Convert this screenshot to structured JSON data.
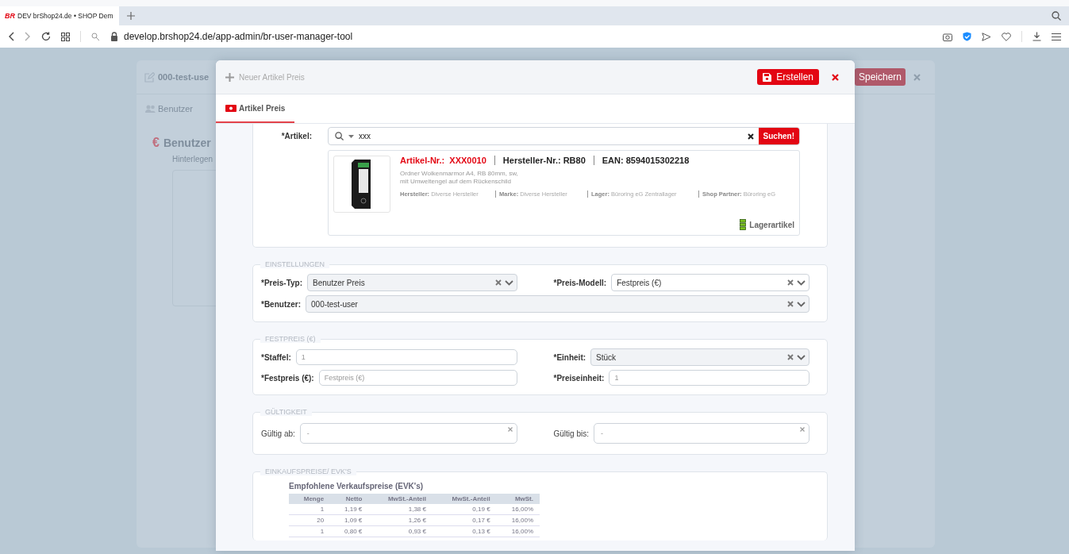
{
  "browser": {
    "logo": "BR",
    "tab_title": "DEV brShop24.de • SHOP Dem",
    "url": "develop.brshop24.de/app-admin/br-user-manager-tool"
  },
  "background": {
    "currency_symbol": "€",
    "title": "000-test-use",
    "tab": "Benutzer",
    "heading": "Benutzer",
    "subtitle": "Hinterlegen",
    "save_button": "Speichern"
  },
  "modal": {
    "title": "Neuer Artikel Preis",
    "create_button": "Erstellen",
    "tabs": [
      {
        "label": "Artikel Preis",
        "selected": true
      }
    ],
    "article": {
      "label": "*Artikel:",
      "search_value": "xxx",
      "search_button": "Suchen!",
      "result": {
        "article_no_label": "Artikel-Nr.:",
        "article_no": "XXX0010",
        "manufacturer_no": "Hersteller-Nr.: RB80",
        "ean": "EAN: 8594015302218",
        "description": [
          "Ordner Wolkenmarmor A4, RB 80mm, sw,",
          "mit Umweltengel auf dem Rückenschild"
        ],
        "attributes": [
          {
            "label": "Hersteller:",
            "value": "Diverse Hersteller"
          },
          {
            "label": "Marke:",
            "value": "Diverse Hersteller"
          },
          {
            "label": "Lager:",
            "value": "Büroring eG Zentrallager"
          },
          {
            "label": "Shop Partner:",
            "value": "Büroring eG"
          }
        ],
        "stock_label": "Lagerartikel"
      }
    },
    "sections": [
      {
        "legend": "EINSTELLUNGEN",
        "rows": [
          [
            {
              "label": "*Preis-Typ:",
              "kind": "select",
              "value": "Benutzer Preis",
              "disabled": true
            },
            {
              "label": "*Preis-Modell:",
              "kind": "select",
              "value": "Festpreis (€)",
              "disabled": false
            }
          ],
          [
            {
              "label": "*Benutzer:",
              "kind": "select",
              "value": "000-test-user",
              "disabled": true
            }
          ]
        ]
      },
      {
        "legend": "FESTPREIS (€)",
        "rows": [
          [
            {
              "label": "*Staffel:",
              "kind": "input",
              "placeholder": "1"
            },
            {
              "label": "*Einheit:",
              "kind": "select",
              "value": "Stück",
              "disabled": true
            }
          ],
          [
            {
              "label": "*Festpreis (€):",
              "kind": "input",
              "placeholder": "Festpreis (€)"
            },
            {
              "label": "*Preiseinheit:",
              "kind": "input",
              "placeholder": "1"
            }
          ]
        ]
      },
      {
        "legend": "GÜLTIGKEIT",
        "rows": [
          [
            {
              "label": "Gültig ab:",
              "kind": "date",
              "placeholder": "-"
            },
            {
              "label": "Gültig bis:",
              "kind": "date",
              "placeholder": "-"
            }
          ]
        ]
      }
    ],
    "purchase": {
      "legend": "EINKAUFSPREISE/ EVK'S",
      "table_title": "Empfohlene Verkaufspreise (EVK's)",
      "columns": [
        "Menge",
        "Netto",
        "MwSt.-Anteil",
        "MwSt.-Anteil",
        "MwSt."
      ],
      "rows": [
        [
          "1",
          "1,19 €",
          "1,38 €",
          "0,19 €",
          "16,00%"
        ],
        [
          "20",
          "1,09 €",
          "1,26 €",
          "0,17 €",
          "16,00%"
        ],
        [
          "1",
          "0,80 €",
          "0,93 €",
          "0,13 €",
          "16,00%"
        ]
      ]
    }
  }
}
